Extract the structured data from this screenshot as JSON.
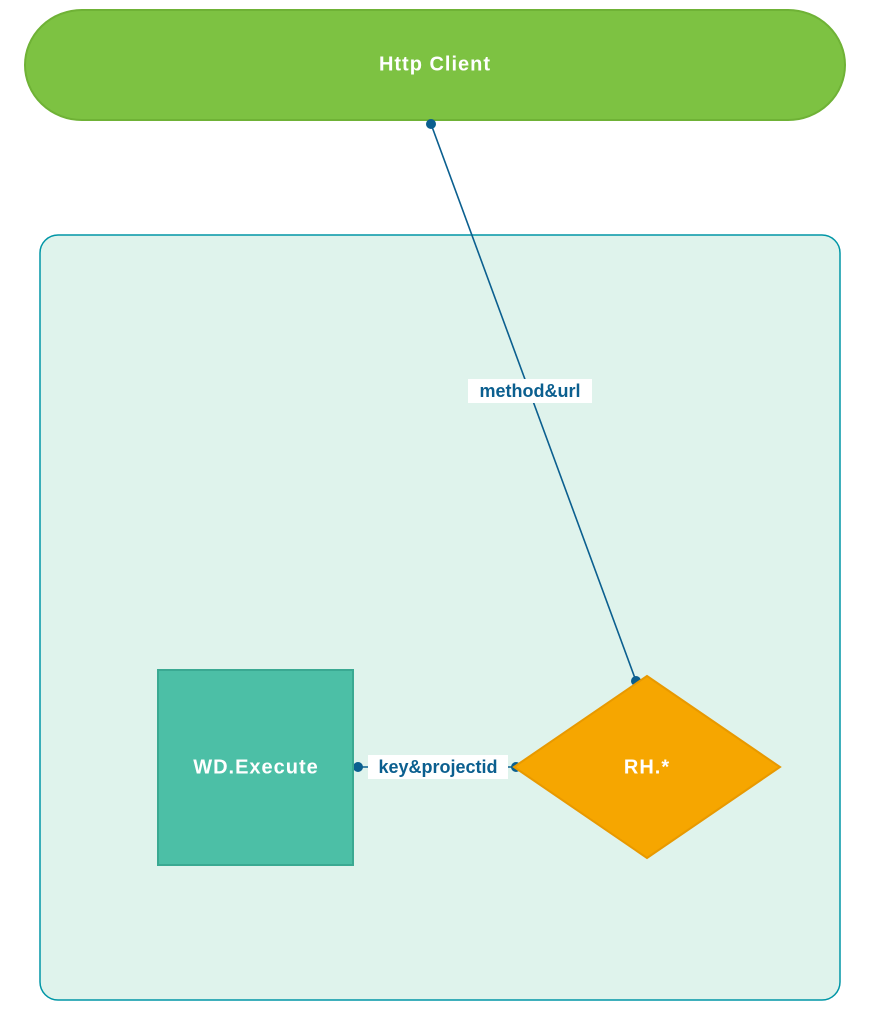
{
  "nodes": {
    "httpClient": {
      "label": "Http  Client"
    },
    "wdExecute": {
      "label": "WD.Execute"
    },
    "rhStar": {
      "label": "RH.*"
    }
  },
  "edges": {
    "methodUrl": {
      "label": "method&url"
    },
    "keyProjectId": {
      "label": "key&projectid"
    }
  },
  "colors": {
    "httpClientFill": "#7dc242",
    "httpClientStroke": "#6fb236",
    "containerFill": "#dff3ec",
    "containerStroke": "#0096a6",
    "wdExecuteFill": "#4cbfa6",
    "wdExecuteStroke": "#3aa992",
    "rhFill": "#f6a600",
    "rhStroke": "#e89900",
    "edgeStroke": "#0b5f8f",
    "edgeDot": "#0b5f8f"
  }
}
